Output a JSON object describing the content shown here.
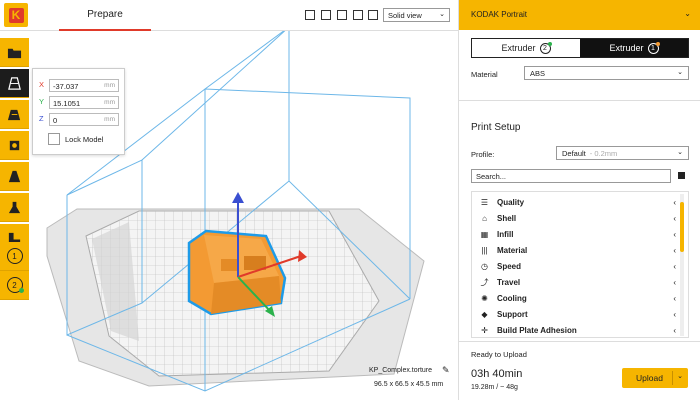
{
  "brand": {
    "logo_letter": "K",
    "accent": "#f6b500",
    "logo_red": "#e03a2a"
  },
  "topbar": {
    "tab_prepare": "Prepare",
    "view_icons": [
      "view-3d-icon",
      "view-front-icon",
      "view-top-icon",
      "view-left-icon",
      "view-right-icon"
    ],
    "view_select": "Solid view"
  },
  "toolbar": {
    "tools": [
      "open-folder-icon",
      "move-icon",
      "scale-icon",
      "rotate-icon",
      "mirror-icon",
      "per-model-settings-icon",
      "support-blocker-icon"
    ],
    "extruder_buttons": [
      "1",
      "2"
    ]
  },
  "coords": {
    "x_label": "X",
    "x_value": "-37.037",
    "x_unit": "mm",
    "y_label": "Y",
    "y_value": "15.1051",
    "y_unit": "mm",
    "z_label": "Z",
    "z_value": "0",
    "z_unit": "mm",
    "lock_label": "Lock Model"
  },
  "model": {
    "name": "KP_Complex.torture",
    "dims": "96.5 x 66.5 x 45.5 mm"
  },
  "panel": {
    "printer": "KODAK Portrait",
    "extruder2": "Extruder",
    "extruder2_num": "2",
    "extruder1": "Extruder",
    "extruder1_num": "1",
    "material_label": "Material",
    "material_value": "ABS",
    "print_setup": "Print Setup",
    "profile_label": "Profile:",
    "profile_value": "Default",
    "profile_sub": "- 0.2mm",
    "search_placeholder": "Search...",
    "settings": [
      {
        "icon": "quality-icon",
        "label": "Quality"
      },
      {
        "icon": "shell-icon",
        "label": "Shell"
      },
      {
        "icon": "infill-icon",
        "label": "Infill"
      },
      {
        "icon": "material-icon",
        "label": "Material"
      },
      {
        "icon": "speed-icon",
        "label": "Speed"
      },
      {
        "icon": "travel-icon",
        "label": "Travel"
      },
      {
        "icon": "cooling-icon",
        "label": "Cooling"
      },
      {
        "icon": "support-icon",
        "label": "Support"
      },
      {
        "icon": "adhesion-icon",
        "label": "Build Plate Adhesion"
      }
    ],
    "ready": "Ready to Upload",
    "time": "03h 40min",
    "usage": "19.28m / ~ 48g",
    "upload": "Upload"
  }
}
